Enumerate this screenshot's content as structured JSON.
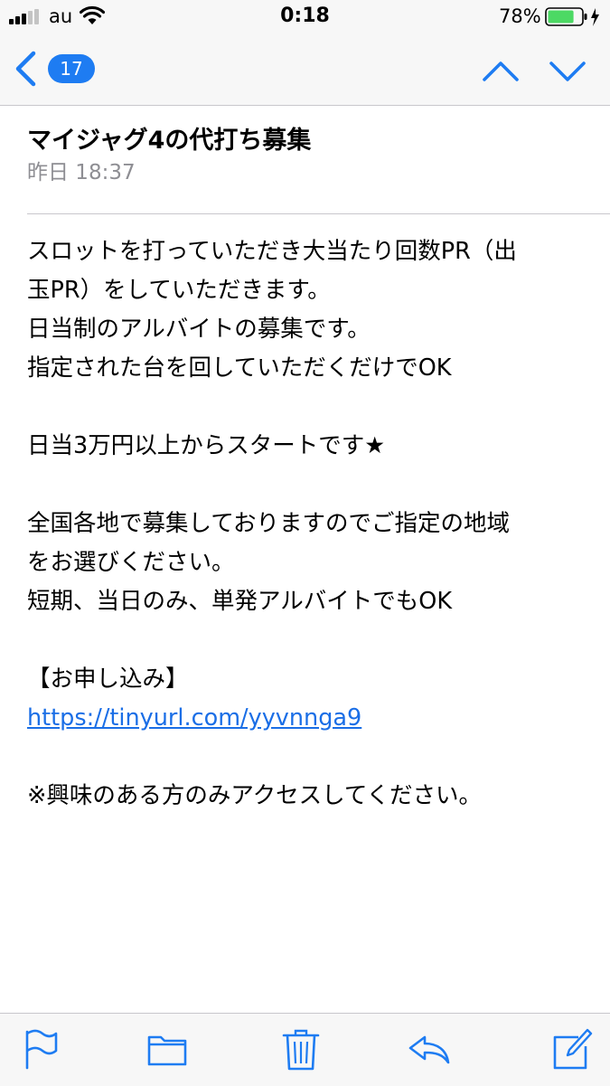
{
  "status_bar": {
    "carrier": "au",
    "time": "0:18",
    "battery_percent": "78%",
    "battery_level": 0.78,
    "charging": true
  },
  "nav": {
    "back_count": "17",
    "accent_color": "#1e7cf2"
  },
  "message": {
    "subject": "マイジャグ4の代打ち募集",
    "timestamp": "昨日 18:37",
    "body_lines": [
      "スロットを打っていただき大当たり回数PR（出",
      "玉PR）をしていただきます。",
      "日当制のアルバイトの募集です。",
      "指定された台を回していただくだけでOK",
      "",
      "日当3万円以上からスタートです★",
      "",
      "全国各地で募集しておりますのでご指定の地域",
      "をお選びください。",
      "短期、当日のみ、単発アルバイトでもOK",
      "",
      "【お申し込み】",
      "https://tinyurl.com/yyvnnga9",
      "",
      "※興味のある方のみアクセスしてください。"
    ],
    "link_color": "#1a6ee6"
  },
  "toolbar": {
    "icons": [
      "flag-icon",
      "folder-icon",
      "trash-icon",
      "reply-icon",
      "compose-icon"
    ]
  }
}
